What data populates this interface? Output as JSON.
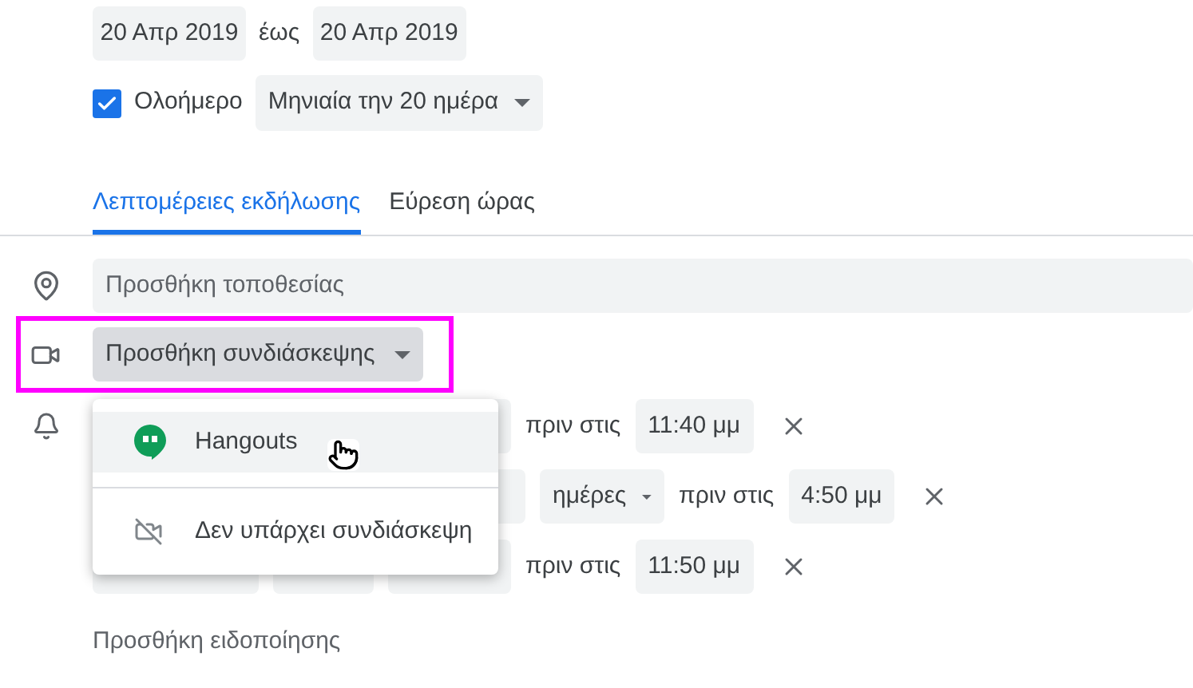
{
  "date_range": {
    "start": "20 Απρ 2019",
    "separator": "έως",
    "end": "20 Απρ 2019"
  },
  "all_day": {
    "label": "Ολοήμερο",
    "checked": true
  },
  "recurrence": {
    "value": "Μηνιαία την 20 ημέρα"
  },
  "tabs": [
    {
      "label": "Λεπτομέρειες εκδήλωσης",
      "selected": true
    },
    {
      "label": "Εύρεση ώρας",
      "selected": false
    }
  ],
  "location": {
    "placeholder": "Προσθήκη τοποθεσίας"
  },
  "conference": {
    "label": "Προσθήκη συνδιάσκεψης",
    "expanded": true,
    "highlighted": true
  },
  "conference_menu": [
    {
      "kind": "hangouts",
      "label": "Hangouts",
      "hovered": true
    },
    {
      "kind": "none",
      "label": "Δεν υπάρχει συνδιάσκεψη",
      "hovered": false
    }
  ],
  "notifications": [
    {
      "before_label": "πριν στις",
      "time": "11:40 μμ"
    },
    {
      "unit": "ημέρες",
      "before_label": "πριν στις",
      "time": "4:50 μμ"
    },
    {
      "before_label": "πριν στις",
      "time": "11:50 μμ"
    }
  ],
  "add_notification": "Προσθήκη ειδοποίησης"
}
